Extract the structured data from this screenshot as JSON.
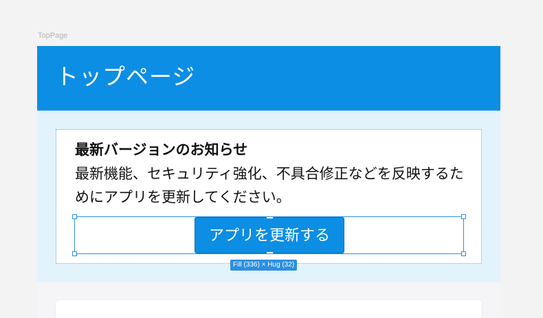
{
  "frame": {
    "label": "TopPage"
  },
  "header": {
    "title": "トップページ",
    "color": "#0b8ee3"
  },
  "notice": {
    "title": "最新バージョンのお知らせ",
    "body": "最新機能、セキュリティ強化、不具合修正などを反映するためにアプリを更新してください。",
    "background": "#e2f3fc"
  },
  "update_button": {
    "label": "アプリを更新する"
  },
  "selection": {
    "size_label": "Fill (336) × Hug (32)",
    "color": "#2d8fe0"
  }
}
